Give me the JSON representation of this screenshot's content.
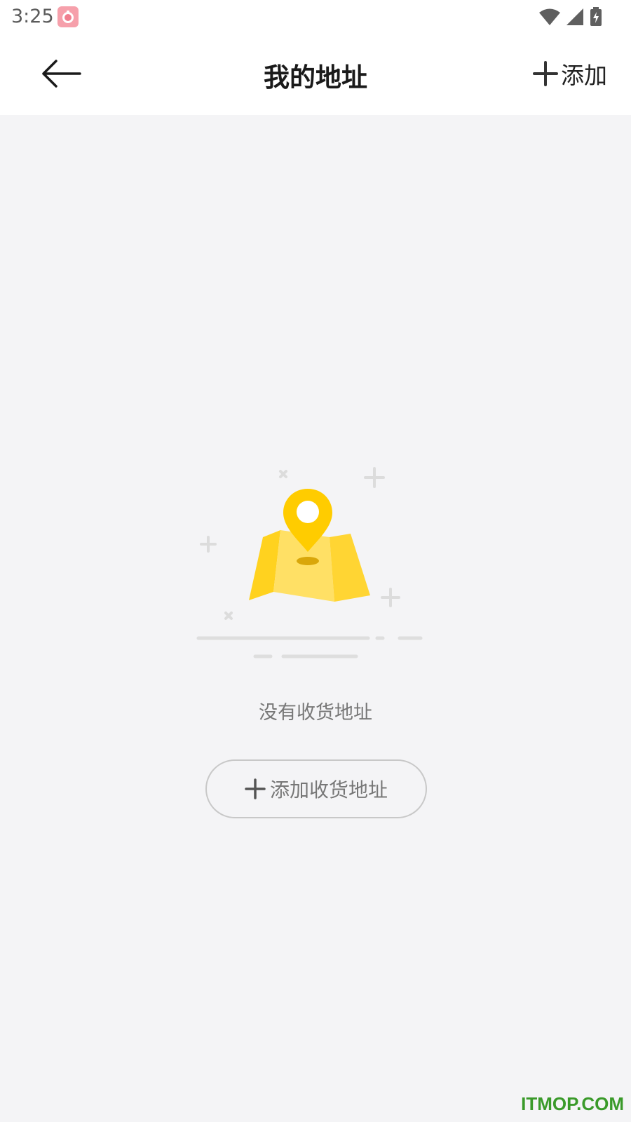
{
  "status_bar": {
    "time": "3:25",
    "app_icon": "fruit-app-icon",
    "wifi_icon": "wifi-icon",
    "signal_icon": "cell-signal-icon",
    "battery_icon": "battery-charging-icon"
  },
  "navbar": {
    "title": "我的地址",
    "back_icon": "arrow-left-icon",
    "add_icon": "plus-icon",
    "add_label": "添加"
  },
  "empty_state": {
    "illustration_icon": "map-pin-illustration",
    "message": "没有收货地址",
    "button_icon": "plus-icon",
    "button_label": "添加收货地址"
  },
  "watermark": "ITMOP.COM",
  "colors": {
    "accent_yellow": "#ffd21f",
    "background": "#f4f4f6",
    "watermark": "#3a9a2a"
  }
}
